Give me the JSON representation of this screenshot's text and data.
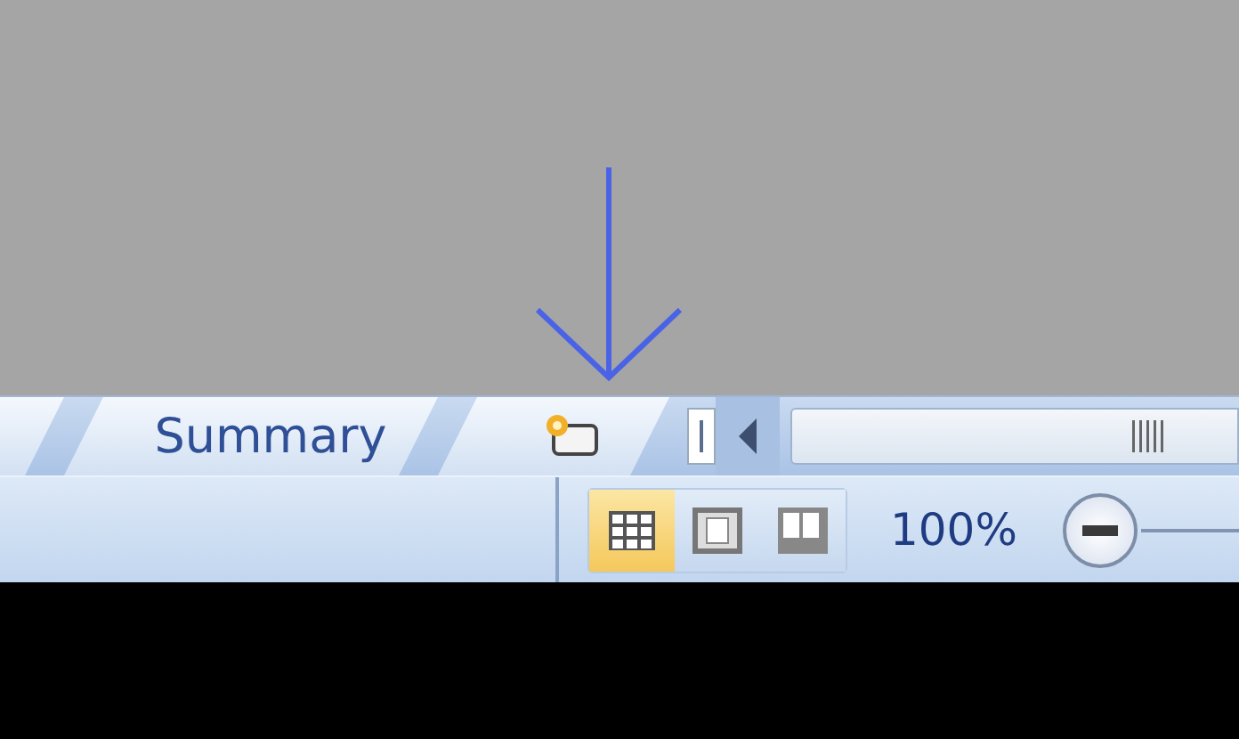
{
  "sheet_tabs": [
    {
      "label": "Summary",
      "kind": "sheet"
    },
    {
      "kind": "insert"
    }
  ],
  "view_buttons": [
    {
      "kind": "normal",
      "selected": true
    },
    {
      "kind": "page_layout",
      "selected": false
    },
    {
      "kind": "page_break",
      "selected": false
    }
  ],
  "zoom": {
    "reading": "100%"
  }
}
